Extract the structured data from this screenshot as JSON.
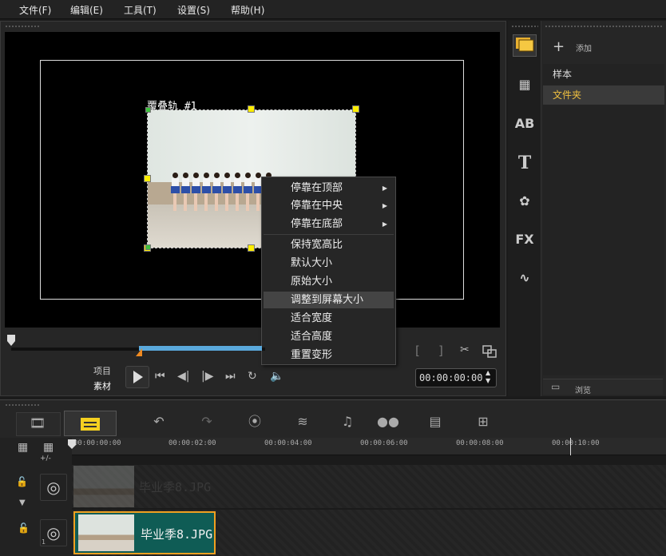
{
  "menu": [
    "文件(F)",
    "编辑(E)",
    "工具(T)",
    "设置(S)",
    "帮助(H)"
  ],
  "preview": {
    "clip_label": "覆叠轨 #1",
    "context_menu": [
      {
        "label": "停靠在顶部",
        "submenu": true
      },
      {
        "label": "停靠在中央",
        "submenu": true
      },
      {
        "label": "停靠在底部",
        "submenu": true
      },
      {
        "label": "保持宽高比"
      },
      {
        "label": "默认大小"
      },
      {
        "label": "原始大小"
      },
      {
        "label": "调整到屏幕大小",
        "highlighted": true
      },
      {
        "label": "适合宽度"
      },
      {
        "label": "适合高度"
      },
      {
        "label": "重置变形"
      }
    ],
    "mode_project": "项目",
    "mode_clip": "素材",
    "timecode": "00:00:00:00",
    "trim_in": "[",
    "trim_out": "]"
  },
  "library": {
    "add_label": "添加",
    "items": [
      "样本",
      "文件夹"
    ],
    "selected": "文件夹",
    "browse_label": "浏览"
  },
  "strip_icons": [
    "media-icon",
    "transition-icon",
    "title-ab-icon",
    "text-t-icon",
    "filter-icon",
    "fx-icon",
    "path-icon"
  ],
  "timeline": {
    "ruler_labels": [
      "00:00:00:00",
      "00:00:02:00",
      "00:00:04:00",
      "00:00:06:00",
      "00:00:08:00",
      "00:00:10:00"
    ],
    "zoom_label": "+/-",
    "overlay_clip_name": "毕业季8.JPG",
    "video_clip_name": "毕业季8.JPG",
    "track_number": "1"
  },
  "colors": {
    "accent_yellow": "#ffee00",
    "selection_blue": "#5aa9dc",
    "clip_orange": "#f0a020"
  }
}
